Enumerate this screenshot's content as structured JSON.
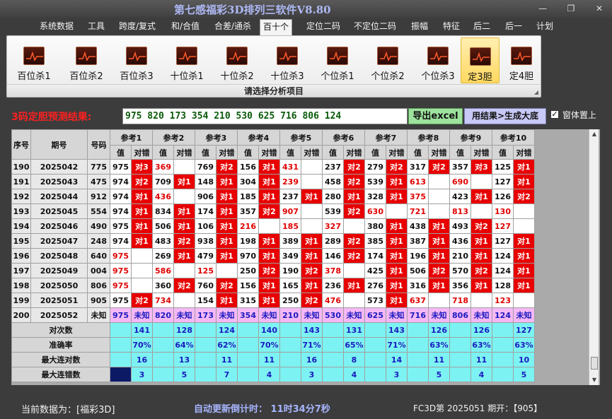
{
  "window": {
    "title": "第七感福彩3D排列三软件V8.80"
  },
  "menu": [
    "系统数据",
    "工具",
    "跨度/复式",
    "和/合值",
    "合差/通杀",
    "百十个",
    "定位二码",
    "不定位二码",
    "振幅",
    "特征",
    "后二",
    "后一",
    "计划"
  ],
  "menu_active": 5,
  "ribbon": {
    "buttons": [
      "百位杀1",
      "百位杀2",
      "百位杀3",
      "十位杀1",
      "十位杀2",
      "十位杀3",
      "个位杀1",
      "个位杀2",
      "个位杀3",
      "定3胆",
      "定4胆"
    ],
    "selected": 9,
    "caption": "请选择分析项目"
  },
  "prediction": {
    "label": "3码定胆预测结果:",
    "value": "975 820 173 354 210 530 625 716 806 124",
    "excel_btn": "导出excel",
    "gen_btn": "用结果>生成大底",
    "topmost_label": "窗体置上",
    "topmost_checked": true
  },
  "table": {
    "headers": {
      "seq": "序号",
      "period": "期号",
      "number": "号码",
      "ref_prefix": "参考",
      "val": "值",
      "duicuo": "对错"
    },
    "refs": [
      "1",
      "2",
      "3",
      "4",
      "5",
      "6",
      "7",
      "8",
      "9",
      "10"
    ],
    "rows": [
      {
        "seq": "190",
        "period": "2025042",
        "num": "775",
        "cells": [
          [
            "975",
            "对3",
            "n"
          ],
          [
            "369",
            "",
            "r"
          ],
          [
            "769",
            "对2",
            "n"
          ],
          [
            "156",
            "对1",
            "n"
          ],
          [
            "431",
            "",
            "r"
          ],
          [
            "237",
            "对2",
            "n"
          ],
          [
            "279",
            "对2",
            "n"
          ],
          [
            "317",
            "对2",
            "n"
          ],
          [
            "357",
            "对3",
            "n"
          ],
          [
            "125",
            "对1",
            "n"
          ]
        ]
      },
      {
        "seq": "191",
        "period": "2025043",
        "num": "475",
        "cells": [
          [
            "974",
            "对2",
            "n"
          ],
          [
            "709",
            "对1",
            "n"
          ],
          [
            "148",
            "对1",
            "n"
          ],
          [
            "304",
            "对1",
            "n"
          ],
          [
            "239",
            "",
            "r"
          ],
          [
            "458",
            "对2",
            "n"
          ],
          [
            "539",
            "对1",
            "n"
          ],
          [
            "613",
            "",
            "r"
          ],
          [
            "690",
            "",
            "r"
          ],
          [
            "127",
            "对1",
            "n"
          ]
        ]
      },
      {
        "seq": "192",
        "period": "2025044",
        "num": "912",
        "cells": [
          [
            "974",
            "对1",
            "n"
          ],
          [
            "436",
            "",
            "r"
          ],
          [
            "906",
            "对1",
            "n"
          ],
          [
            "185",
            "对1",
            "n"
          ],
          [
            "237",
            "对1",
            "n"
          ],
          [
            "280",
            "对1",
            "n"
          ],
          [
            "328",
            "对1",
            "n"
          ],
          [
            "375",
            "",
            "r"
          ],
          [
            "423",
            "对1",
            "n"
          ],
          [
            "126",
            "对2",
            "n"
          ]
        ]
      },
      {
        "seq": "193",
        "period": "2025045",
        "num": "554",
        "cells": [
          [
            "974",
            "对1",
            "n"
          ],
          [
            "834",
            "对1",
            "n"
          ],
          [
            "174",
            "对1",
            "n"
          ],
          [
            "357",
            "对2",
            "n"
          ],
          [
            "907",
            "",
            "r"
          ],
          [
            "539",
            "对2",
            "n"
          ],
          [
            "630",
            "",
            "r"
          ],
          [
            "721",
            "",
            "r"
          ],
          [
            "813",
            "",
            "r"
          ],
          [
            "130",
            "",
            "r"
          ]
        ]
      },
      {
        "seq": "194",
        "period": "2025046",
        "num": "490",
        "cells": [
          [
            "975",
            "对1",
            "n"
          ],
          [
            "506",
            "对1",
            "n"
          ],
          [
            "106",
            "对1",
            "n"
          ],
          [
            "216",
            "",
            "r"
          ],
          [
            "185",
            "",
            "r"
          ],
          [
            "327",
            "",
            "r"
          ],
          [
            "380",
            "对1",
            "n"
          ],
          [
            "438",
            "对1",
            "n"
          ],
          [
            "493",
            "对2",
            "n"
          ],
          [
            "127",
            "",
            "r"
          ]
        ]
      },
      {
        "seq": "195",
        "period": "2025047",
        "num": "248",
        "cells": [
          [
            "974",
            "对1",
            "n"
          ],
          [
            "483",
            "对2",
            "n"
          ],
          [
            "938",
            "对1",
            "n"
          ],
          [
            "198",
            "对1",
            "n"
          ],
          [
            "389",
            "对1",
            "n"
          ],
          [
            "289",
            "对2",
            "n"
          ],
          [
            "385",
            "对1",
            "n"
          ],
          [
            "387",
            "对1",
            "n"
          ],
          [
            "436",
            "对1",
            "n"
          ],
          [
            "127",
            "对1",
            "n"
          ]
        ]
      },
      {
        "seq": "196",
        "period": "2025048",
        "num": "640",
        "cells": [
          [
            "975",
            "",
            "r"
          ],
          [
            "269",
            "对1",
            "n"
          ],
          [
            "479",
            "对1",
            "n"
          ],
          [
            "970",
            "对1",
            "n"
          ],
          [
            "349",
            "对1",
            "n"
          ],
          [
            "146",
            "对2",
            "n"
          ],
          [
            "174",
            "对1",
            "n"
          ],
          [
            "196",
            "对1",
            "n"
          ],
          [
            "210",
            "对1",
            "n"
          ],
          [
            "124",
            "对1",
            "n"
          ]
        ]
      },
      {
        "seq": "197",
        "period": "2025049",
        "num": "004",
        "cells": [
          [
            "975",
            "",
            "r"
          ],
          [
            "586",
            "",
            "r"
          ],
          [
            "125",
            "",
            "r"
          ],
          [
            "250",
            "对2",
            "n"
          ],
          [
            "190",
            "对2",
            "n"
          ],
          [
            "378",
            "",
            "r"
          ],
          [
            "425",
            "对1",
            "n"
          ],
          [
            "506",
            "对2",
            "n"
          ],
          [
            "570",
            "对2",
            "n"
          ],
          [
            "124",
            "对1",
            "n"
          ]
        ]
      },
      {
        "seq": "198",
        "period": "2025050",
        "num": "806",
        "cells": [
          [
            "975",
            "",
            "r"
          ],
          [
            "360",
            "对2",
            "n"
          ],
          [
            "760",
            "对2",
            "n"
          ],
          [
            "156",
            "对1",
            "n"
          ],
          [
            "165",
            "对1",
            "n"
          ],
          [
            "236",
            "对1",
            "n"
          ],
          [
            "276",
            "对1",
            "n"
          ],
          [
            "316",
            "对1",
            "n"
          ],
          [
            "356",
            "对1",
            "n"
          ],
          [
            "128",
            "对1",
            "n"
          ]
        ]
      },
      {
        "seq": "199",
        "period": "2025051",
        "num": "905",
        "cells": [
          [
            "975",
            "对2",
            "n"
          ],
          [
            "734",
            "",
            "r"
          ],
          [
            "154",
            "对1",
            "n"
          ],
          [
            "315",
            "对1",
            "n"
          ],
          [
            "250",
            "对2",
            "n"
          ],
          [
            "476",
            "",
            "r"
          ],
          [
            "573",
            "对1",
            "n"
          ],
          [
            "637",
            "",
            "r"
          ],
          [
            "718",
            "",
            "r"
          ],
          [
            "123",
            "",
            "r"
          ]
        ]
      }
    ],
    "pred_row": {
      "seq": "200",
      "period": "2025052",
      "num": "未知",
      "vals": [
        "975",
        "820",
        "173",
        "354",
        "210",
        "530",
        "625",
        "716",
        "806",
        "124"
      ],
      "unknown": "未知"
    },
    "stats": [
      {
        "label": "对次数",
        "vals": [
          "141",
          "128",
          "124",
          "140",
          "143",
          "131",
          "143",
          "126",
          "126",
          "127"
        ]
      },
      {
        "label": "准确率",
        "vals": [
          "70%",
          "64%",
          "62%",
          "70%",
          "71%",
          "65%",
          "71%",
          "63%",
          "63%",
          "63%"
        ]
      },
      {
        "label": "最大连对数",
        "vals": [
          "16",
          "13",
          "11",
          "11",
          "16",
          "8",
          "14",
          "11",
          "11",
          "10"
        ]
      },
      {
        "label": "最大连错数",
        "vals": [
          "3",
          "5",
          "7",
          "4",
          "3",
          "4",
          "3",
          "5",
          "4",
          "5"
        ]
      }
    ]
  },
  "status": {
    "current": "当前数据为：[福彩3D]",
    "countdown": "自动更新倒计时：  11时34分7秒",
    "issue": "FC3D第 2025051 期开：【905】"
  }
}
